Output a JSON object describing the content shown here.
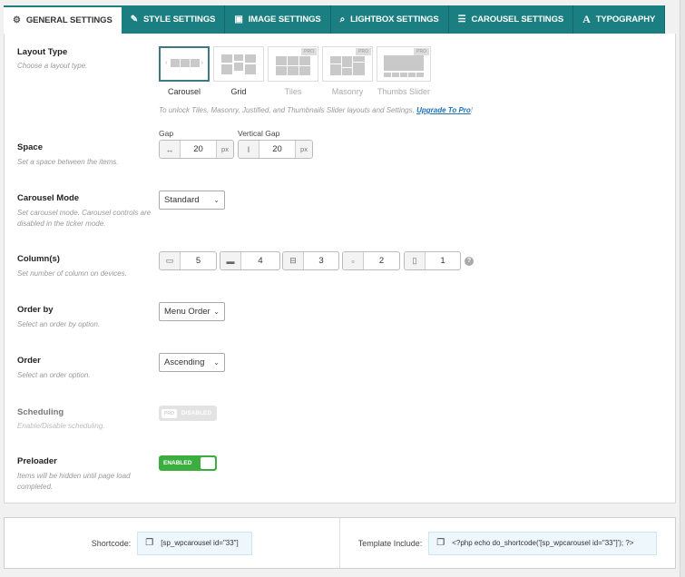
{
  "tabs": [
    {
      "label": "GENERAL SETTINGS",
      "icon": "gear-icon",
      "glyph": "⚙",
      "active": true
    },
    {
      "label": "STYLE SETTINGS",
      "icon": "brush-icon",
      "glyph": "✎",
      "active": false
    },
    {
      "label": "IMAGE SETTINGS",
      "icon": "image-icon",
      "glyph": "▣",
      "active": false
    },
    {
      "label": "LIGHTBOX SETTINGS",
      "icon": "search-icon",
      "glyph": "⌕",
      "active": false
    },
    {
      "label": "CAROUSEL SETTINGS",
      "icon": "sliders-icon",
      "glyph": "☰",
      "active": false
    },
    {
      "label": "TYPOGRAPHY",
      "icon": "font-icon",
      "glyph": "A",
      "active": false
    }
  ],
  "layout_type": {
    "label": "Layout Type",
    "desc": "Choose a layout type.",
    "options": [
      {
        "label": "Carousel",
        "selected": true,
        "pro": false
      },
      {
        "label": "Grid",
        "selected": false,
        "pro": false
      },
      {
        "label": "Tiles",
        "selected": false,
        "pro": true
      },
      {
        "label": "Masonry",
        "selected": false,
        "pro": true
      },
      {
        "label": "Thumbs Slider",
        "selected": false,
        "pro": true
      }
    ],
    "pro_tag": "PRO",
    "unlock_text": "To unlock Tiles, Masonry, Justified, and Thumbnails Slider layouts and Settings, ",
    "upgrade_link": "Upgrade To Pro",
    "unlock_suffix": "!"
  },
  "space": {
    "label": "Space",
    "desc": "Set a space between the items.",
    "gap_label": "Gap",
    "gap_value": "20",
    "vgap_label": "Vertical Gap",
    "vgap_value": "20",
    "unit": "px"
  },
  "carousel_mode": {
    "label": "Carousel Mode",
    "desc": "Set carousel mode. Carousel controls are disabled in the ticker mode.",
    "value": "Standard"
  },
  "columns": {
    "label": "Column(s)",
    "desc": "Set number of column on devices.",
    "devices": [
      {
        "icon": "large-desktop-icon",
        "value": "5"
      },
      {
        "icon": "desktop-icon",
        "value": "4"
      },
      {
        "icon": "laptop-icon",
        "value": "3"
      },
      {
        "icon": "tablet-icon",
        "value": "2"
      },
      {
        "icon": "mobile-icon",
        "value": "1"
      }
    ],
    "help": "?"
  },
  "order_by": {
    "label": "Order by",
    "desc": "Select an order by option.",
    "value": "Menu Order"
  },
  "order": {
    "label": "Order",
    "desc": "Select an order option.",
    "value": "Ascending"
  },
  "scheduling": {
    "label": "Scheduling",
    "desc": "Enable/Disable scheduling.",
    "pro": "PRO",
    "state": "DISABLED"
  },
  "preloader": {
    "label": "Preloader",
    "desc": "Items will be hidden until page load completed.",
    "state": "ENABLED"
  },
  "footer": {
    "shortcode_label": "Shortcode:",
    "shortcode": "[sp_wpcarousel id=\"33\"]",
    "template_label": "Template Include:",
    "template": "<?php echo do_shortcode('[sp_wpcarousel id=\"33\"]'); ?>"
  }
}
